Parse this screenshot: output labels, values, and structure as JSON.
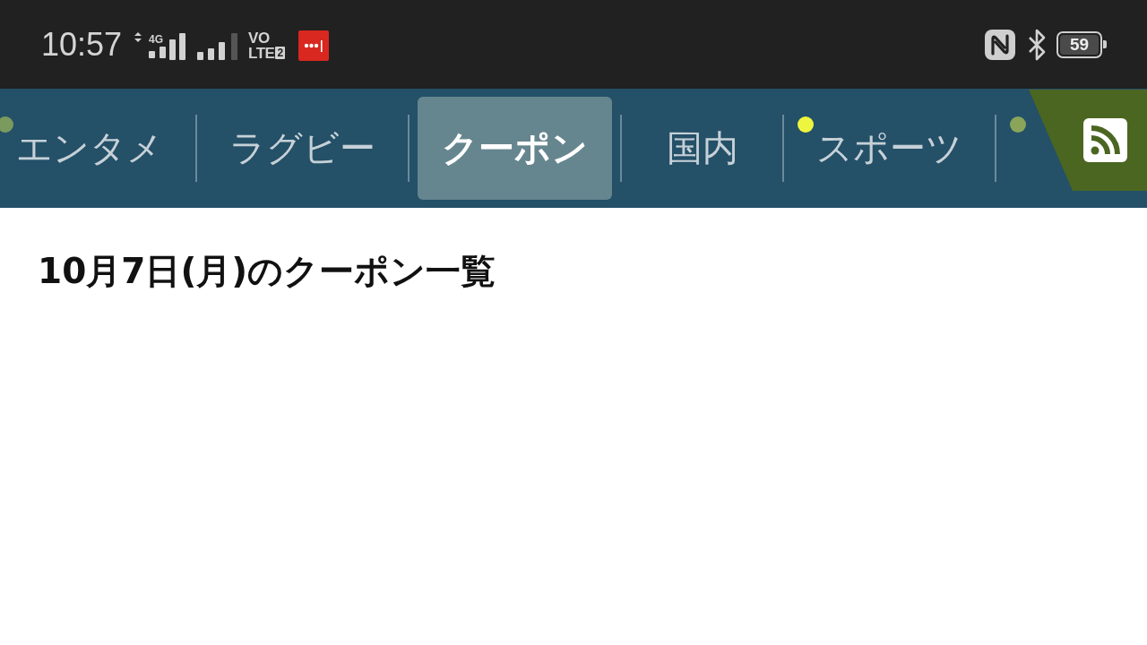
{
  "status_bar": {
    "time": "10:57",
    "network_type": "4G",
    "volte": {
      "top": "VO",
      "bottom": "LTE",
      "sim": "2"
    },
    "battery": "59"
  },
  "tabs": [
    {
      "label": "エンタメ",
      "selected": false,
      "color": "#7a9a5e"
    },
    {
      "label": "ラグビー",
      "selected": false
    },
    {
      "label": "クーポン",
      "selected": true
    },
    {
      "label": "国内",
      "selected": false
    },
    {
      "label": "スポーツ",
      "selected": false,
      "color": "#eef53f"
    },
    {
      "selected": false,
      "color": "#8aa45a"
    }
  ],
  "page": {
    "heading": "10月7日(月)のクーポン一覧"
  }
}
